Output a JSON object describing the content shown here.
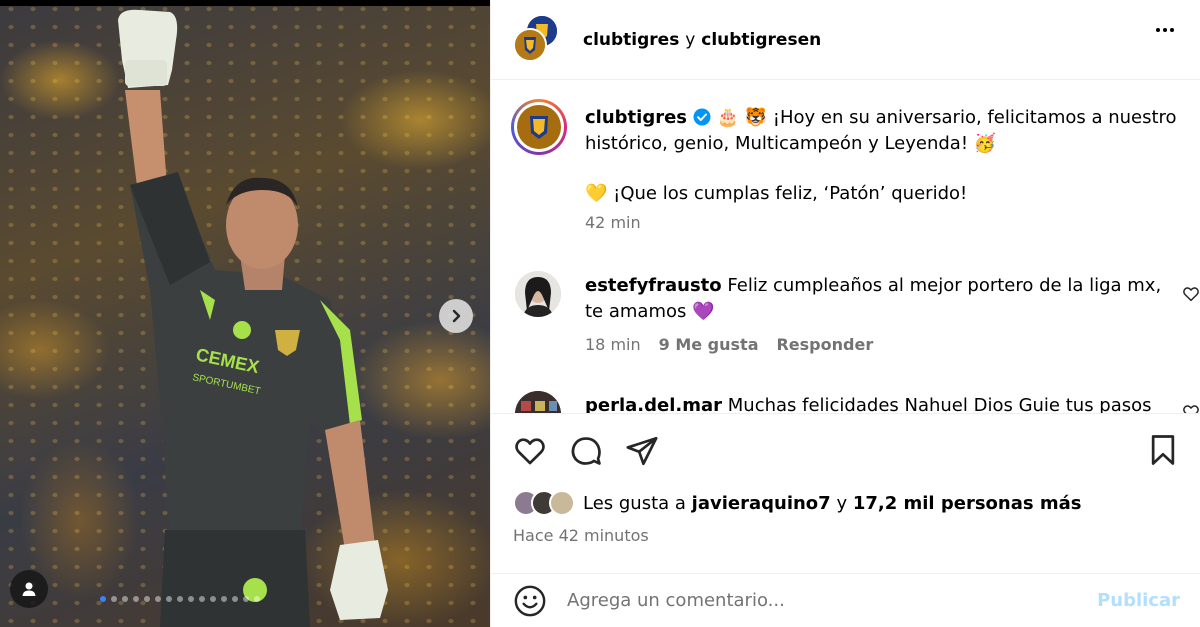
{
  "header": {
    "account1": "clubtigres",
    "connector": "y",
    "account2": "clubtigresen"
  },
  "caption": {
    "username": "clubtigres",
    "text_line1": "🎂 🐯 ¡Hoy en su aniversario, felicitamos a nuestro",
    "text_line2": "histórico, genio, Multicampeón y Leyenda! 🥳",
    "text_line3": "💛 ¡Que los cumplas feliz, ‘Patón’ querido!",
    "time": "42 min"
  },
  "comments": [
    {
      "username": "estefyfrausto",
      "text_line1": "Feliz cumpleaños al mejor portero de la liga mx,",
      "text_line2": "te amamos 💜",
      "time": "18 min",
      "likes": "9 Me gusta",
      "reply": "Responder"
    },
    {
      "username": "perla.del.mar",
      "text_line1": "Muchas felicidades Nahuel Dios Guie tus pasos"
    }
  ],
  "likes": {
    "prefix": "Les gusta a",
    "user": "javieraquino7",
    "connector": "y",
    "others": "17,2 mil personas más"
  },
  "post_time": "Hace 42 minutos",
  "add_comment": {
    "placeholder": "Agrega un comentario...",
    "publish_label": "Publicar"
  },
  "carousel": {
    "count": 15,
    "active_index": 0
  },
  "colors": {
    "verified": "#0095f6",
    "publish_disabled": "#b2dffc",
    "muted_text": "#737373",
    "jersey": "#3b3f40",
    "jersey_accent": "#a6e04a"
  }
}
